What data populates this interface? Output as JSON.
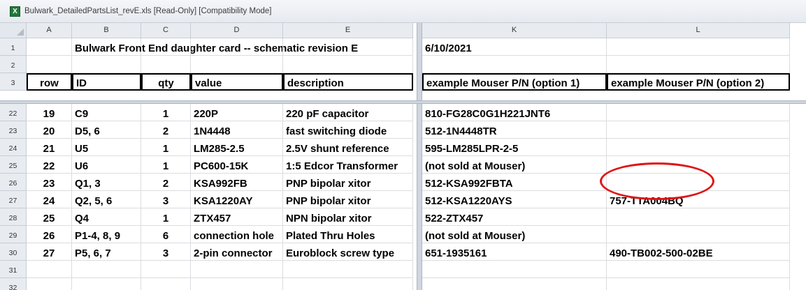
{
  "window": {
    "title": "Bulwark_DetailedPartsList_revE.xls  [Read-Only]  [Compatibility Mode]",
    "icon": "excel-icon"
  },
  "columns": [
    "A",
    "B",
    "C",
    "D",
    "E",
    "K",
    "L"
  ],
  "top_rows": [
    {
      "num": "1",
      "cells": {
        "B": "Bulwark Front End daughter card -- schematic revision E",
        "K": "6/10/2021"
      }
    },
    {
      "num": "2",
      "cells": {}
    },
    {
      "num": "3",
      "header": true,
      "cells": {
        "A": "row",
        "B": "ID",
        "C": "qty",
        "D": "value",
        "E": "description",
        "K": "example Mouser P/N (option 1)",
        "L": "example Mouser P/N (option 2)"
      }
    }
  ],
  "rows": [
    {
      "num": "22",
      "cells": {
        "A": "19",
        "B": "C9",
        "C": "1",
        "D": "220P",
        "E": "220 pF capacitor",
        "K": "810-FG28C0G1H221JNT6"
      }
    },
    {
      "num": "23",
      "cells": {
        "A": "20",
        "B": "D5, 6",
        "C": "2",
        "D": "1N4448",
        "E": "fast switching diode",
        "K": "512-1N4448TR"
      }
    },
    {
      "num": "24",
      "cells": {
        "A": "21",
        "B": "U5",
        "C": "1",
        "D": "LM285-2.5",
        "E": "2.5V shunt reference",
        "K": "595-LM285LPR-2-5"
      }
    },
    {
      "num": "25",
      "cells": {
        "A": "22",
        "B": "U6",
        "C": "1",
        "D": "PC600-15K",
        "E": "1:5 Edcor Transformer",
        "K": "(not sold at Mouser)"
      }
    },
    {
      "num": "26",
      "cells": {
        "A": "23",
        "B": "Q1, 3",
        "C": "2",
        "D": "KSA992FB",
        "E": "PNP bipolar xitor",
        "K": "512-KSA992FBTA"
      }
    },
    {
      "num": "27",
      "cells": {
        "A": "24",
        "B": "Q2, 5, 6",
        "C": "3",
        "D": "KSA1220AY",
        "E": "PNP bipolar xitor",
        "K": "512-KSA1220AYS",
        "L": "757-TTA004BQ"
      }
    },
    {
      "num": "28",
      "cells": {
        "A": "25",
        "B": "Q4",
        "C": "1",
        "D": "ZTX457",
        "E": "NPN bipolar xitor",
        "K": "522-ZTX457"
      }
    },
    {
      "num": "29",
      "cells": {
        "A": "26",
        "B": "P1-4, 8, 9",
        "C": "6",
        "D": "connection hole",
        "E": "Plated Thru Holes",
        "K": "(not sold at Mouser)"
      }
    },
    {
      "num": "30",
      "cells": {
        "A": "27",
        "B": "P5, 6, 7",
        "C": "3",
        "D": "2-pin connector",
        "E": "Euroblock screw type",
        "K": "651-1935161",
        "L": "490-TB002-500-02BE"
      }
    },
    {
      "num": "31",
      "cells": {}
    },
    {
      "num": "32",
      "cells": {}
    }
  ],
  "annotation": {
    "circled_cell": "L27",
    "color": "#e01515"
  }
}
